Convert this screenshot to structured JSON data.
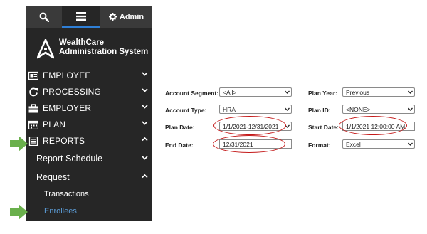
{
  "topbar": {
    "admin_label": "Admin"
  },
  "logo": {
    "line1": "WealthCare",
    "line2": "Administration System"
  },
  "nav": {
    "employee": "EMPLOYEE",
    "processing": "PROCESSING",
    "employer": "EMPLOYER",
    "plan": "PLAN",
    "reports": "REPORTS"
  },
  "reports_menu": {
    "report_schedule": "Report Schedule",
    "request": "Request",
    "transactions": "Transactions",
    "enrollees": "Enrollees"
  },
  "form": {
    "account_segment": {
      "label": "Account Segment:",
      "value": "<All>"
    },
    "plan_year": {
      "label": "Plan Year:",
      "value": "Previous"
    },
    "account_type": {
      "label": "Account Type:",
      "value": "HRA"
    },
    "plan_id": {
      "label": "Plan ID:",
      "value": "<NONE>"
    },
    "plan_date": {
      "label": "Plan Date:",
      "value": "1/1/2021-12/31/2021"
    },
    "start_date": {
      "label": "Start Date:",
      "value": "1/1/2021 12:00:00 AM"
    },
    "end_date": {
      "label": "End Date:",
      "value": "12/31/2021"
    },
    "format": {
      "label": "Format:",
      "value": "Excel"
    }
  },
  "colors": {
    "sidebar_bg": "#262626",
    "accent": "#2f7fd6",
    "active_link": "#5b9bd5",
    "highlight_oval": "#c41a1a",
    "pointer_arrow": "#6ab04c"
  }
}
